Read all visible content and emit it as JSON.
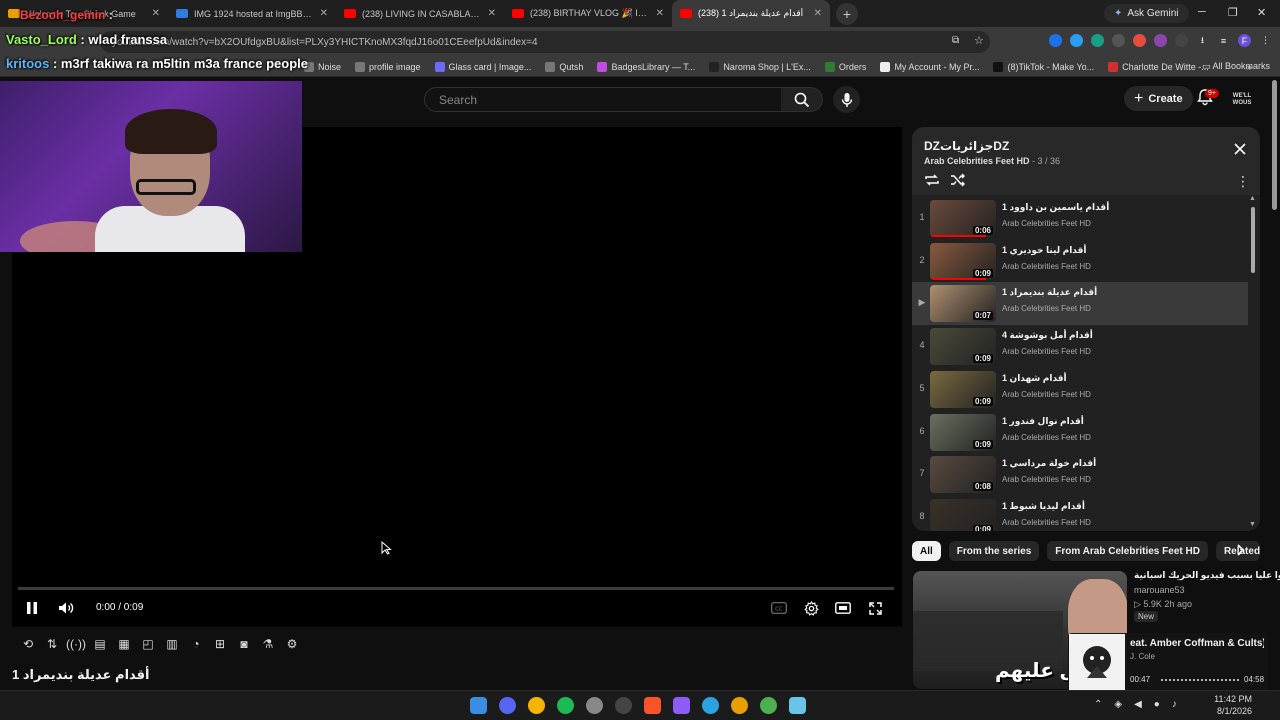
{
  "browser": {
    "tabs": [
      {
        "title": "Welcome To - Check Game",
        "fav_color": "#e8a000"
      },
      {
        "title": "IMG 1924 hosted at ImgBB — I",
        "fav_color": "#2f7de1"
      },
      {
        "title": "(238) LIVING IN CASABLANCA",
        "fav_color": "#ff0000"
      },
      {
        "title": "(238) BIRTHAY VLOG 🎉 IM MA",
        "fav_color": "#ff0000"
      },
      {
        "title": "(238) أقدام عديلة بنديمراد 1",
        "fav_color": "#ff0000"
      }
    ],
    "ask_gemini": "Ask Gemini",
    "url": "youtube.com/watch?v=bX2OUfdgxBU&list=PLXy3YHICTKnoMX3fqdJ16o01CEeefpUd&index=4",
    "bookmarks": [
      "Noise",
      "profile image",
      "Glass card | Image...",
      "Qutsh",
      "BadgesLibrary — T...",
      "Naroma Shop | L'Ex...",
      "Orders",
      "My Account - My Pr...",
      "(8)TikTok - Make Yo...",
      "Charlotte De Witte -..."
    ],
    "all_bookmarks": "All Bookmarks"
  },
  "chat": [
    {
      "user": "Bezooh_gemin",
      "message": ":",
      "color": "u0"
    },
    {
      "user": "Vasto_Lord",
      "message": ": wlad franssa",
      "color": "u1"
    },
    {
      "user": "kritoos",
      "message": ": m3rf takiwa ra m5ltin m3a france people",
      "color": "u2"
    }
  ],
  "youtube": {
    "search_placeholder": "Search",
    "create_label": "Create",
    "notif_count": "9+",
    "avatar_text": "WE'LL WOUS",
    "player": {
      "time": "0:00 / 0:09",
      "progress": 0.0
    },
    "video_title": "أقدام عديلة بنديمراد 1",
    "playlist": {
      "title": "DZجزائرياتDZ",
      "channel": "Arab Celebrities Feet HD",
      "position": " - 3 / 36",
      "items": [
        {
          "idx": "1",
          "title": "أقدام ياسمين بن داوود 1",
          "channel": "Arab Celebrities Feet HD",
          "duration": "0:06",
          "watched": 0.85,
          "thumb": "#6b4a3a"
        },
        {
          "idx": "2",
          "title": "أقدام لينا خوديري 1",
          "channel": "Arab Celebrities Feet HD",
          "duration": "0:09",
          "watched": 0.85,
          "thumb": "#8a5a40"
        },
        {
          "idx": "▶",
          "title": "أقدام عديلة بنديمراد 1",
          "channel": "Arab Celebrities Feet HD",
          "duration": "0:07",
          "watched": 0,
          "thumb": "#b09070"
        },
        {
          "idx": "4",
          "title": "أقدام أمل بوشوشة 4",
          "channel": "Arab Celebrities Feet HD",
          "duration": "0:09",
          "watched": 0,
          "thumb": "#4a4a3a"
        },
        {
          "idx": "5",
          "title": "أقدام شهدان 1",
          "channel": "Arab Celebrities Feet HD",
          "duration": "0:09",
          "watched": 0,
          "thumb": "#7a6a40"
        },
        {
          "idx": "6",
          "title": "أقدام نوال فندور 1",
          "channel": "Arab Celebrities Feet HD",
          "duration": "0:09",
          "watched": 0,
          "thumb": "#6a7060"
        },
        {
          "idx": "7",
          "title": "أقدام خولة مرداسي 1",
          "channel": "Arab Celebrities Feet HD",
          "duration": "0:08",
          "watched": 0,
          "thumb": "#5a4a40"
        },
        {
          "idx": "8",
          "title": "أقدام ليديا شبوط 1",
          "channel": "Arab Celebrities Feet HD",
          "duration": "0:09",
          "watched": 0,
          "thumb": "#3a3028"
        }
      ]
    },
    "chips": [
      "All",
      "From the series",
      "From Arab Celebrities Feet HD",
      "Related"
    ],
    "recommended": {
      "title": "هجموا عليا بسبب فيديو الحريك اسبانية",
      "channel": "marouane53",
      "meta": "▷ 5.9K  2h ago",
      "badge": "New",
      "overlay": "اسهل عليهم"
    }
  },
  "music": {
    "title": "eat. Amber Coffman & Cults)",
    "artist": "J. Cole",
    "elapsed": "00:47",
    "total": "04:58"
  },
  "taskbar": {
    "time": "11:42 PM",
    "date": "8/1/2026"
  }
}
